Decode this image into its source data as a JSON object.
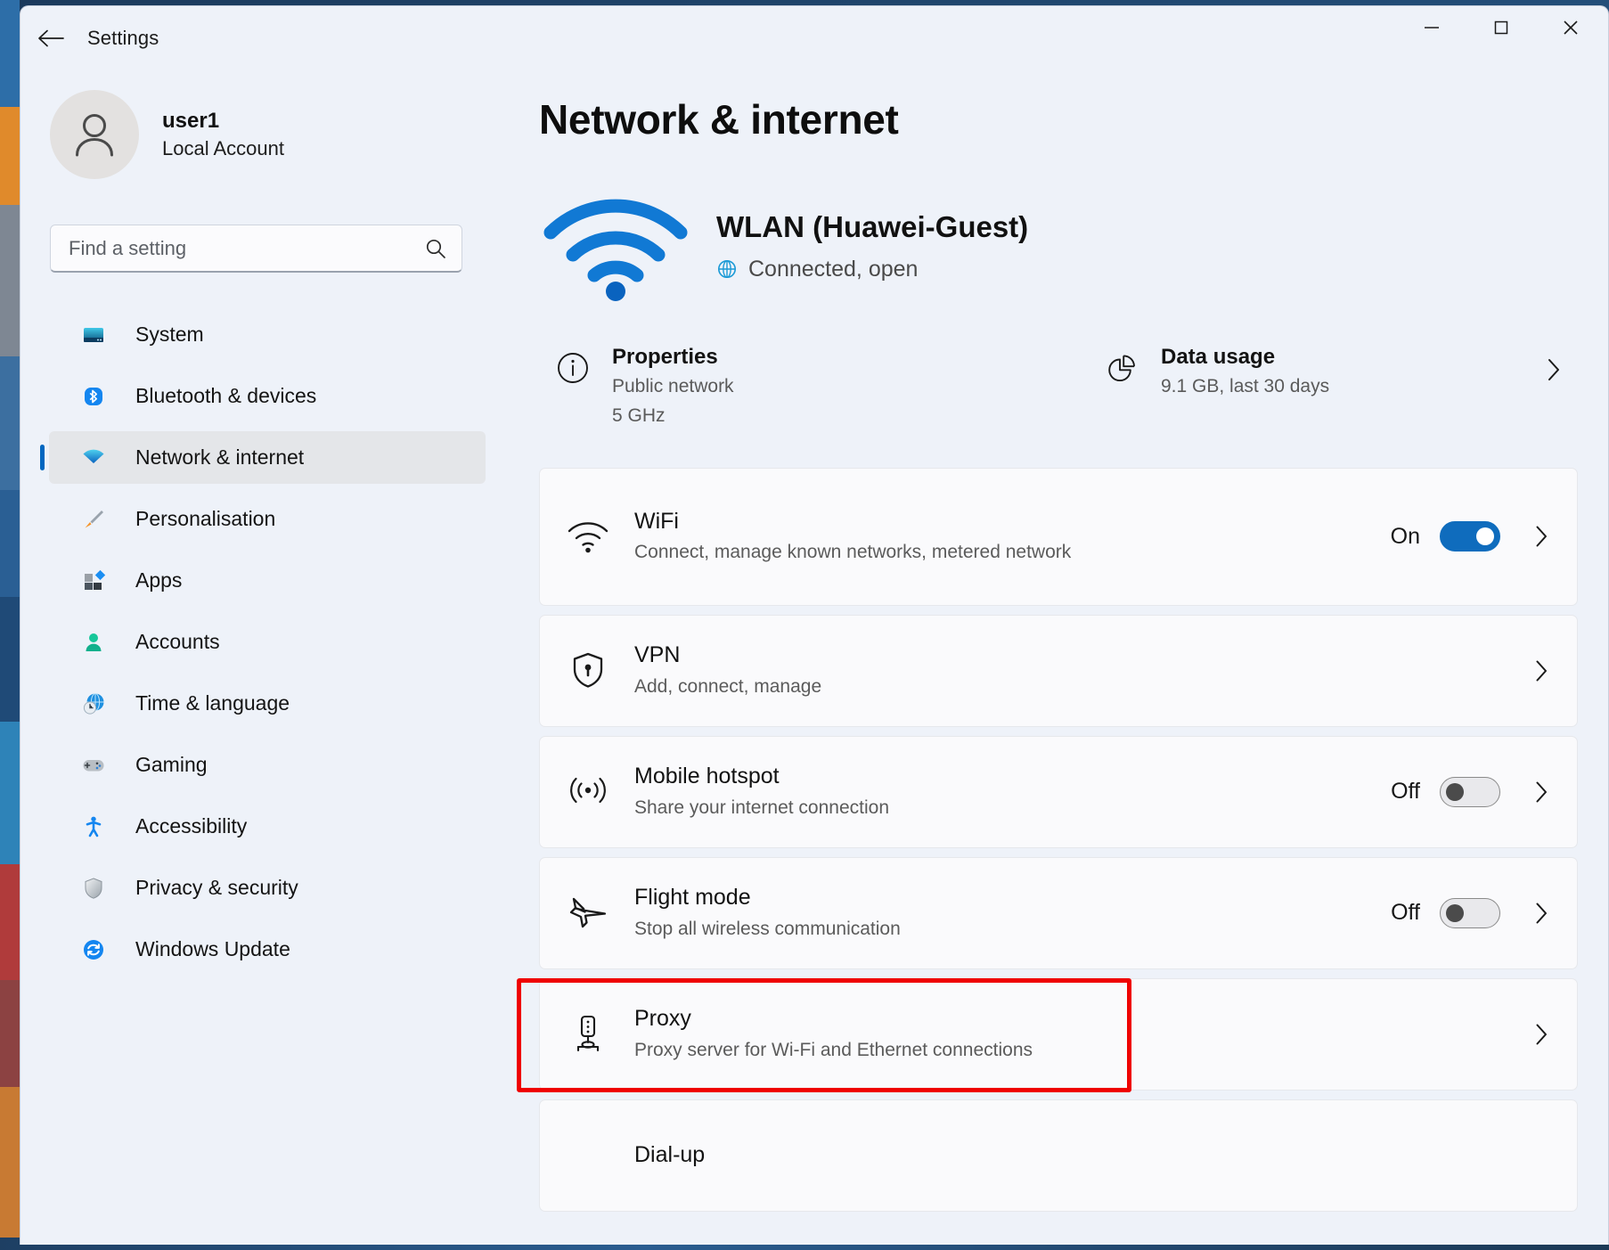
{
  "window": {
    "title": "Settings",
    "back_label": "Back",
    "minimize_label": "Minimize",
    "maximize_label": "Maximize",
    "close_label": "Close"
  },
  "account": {
    "name": "user1",
    "type": "Local Account"
  },
  "search": {
    "placeholder": "Find a setting",
    "value": ""
  },
  "sidebar": {
    "items": [
      {
        "label": "System",
        "icon": "monitor-icon",
        "active": false
      },
      {
        "label": "Bluetooth & devices",
        "icon": "bluetooth-icon",
        "active": false
      },
      {
        "label": "Network & internet",
        "icon": "wifi-icon",
        "active": true
      },
      {
        "label": "Personalisation",
        "icon": "paintbrush-icon",
        "active": false
      },
      {
        "label": "Apps",
        "icon": "apps-icon",
        "active": false
      },
      {
        "label": "Accounts",
        "icon": "person-icon",
        "active": false
      },
      {
        "label": "Time & language",
        "icon": "clock-globe-icon",
        "active": false
      },
      {
        "label": "Gaming",
        "icon": "gamepad-icon",
        "active": false
      },
      {
        "label": "Accessibility",
        "icon": "accessibility-icon",
        "active": false
      },
      {
        "label": "Privacy & security",
        "icon": "shield-icon",
        "active": false
      },
      {
        "label": "Windows Update",
        "icon": "update-icon",
        "active": false
      }
    ]
  },
  "main": {
    "page_title": "Network & internet",
    "hero": {
      "icon": "wifi-signal-icon",
      "name": "WLAN (Huawei-Guest)",
      "status_icon": "globe-icon",
      "status": "Connected, open"
    },
    "summary": [
      {
        "icon": "info-icon",
        "title": "Properties",
        "sub1": "Public network",
        "sub2": "5 GHz",
        "chevron": false
      },
      {
        "icon": "pie-chart-icon",
        "title": "Data usage",
        "sub1": "9.1 GB, last 30 days",
        "sub2": "",
        "chevron": true
      }
    ],
    "cards": [
      {
        "icon": "wifi-small-icon",
        "title": "WiFi",
        "sub": "Connect, manage known networks, metered network",
        "state": "On",
        "toggle": "on",
        "chevron": true,
        "highlighted": false
      },
      {
        "icon": "vpn-shield-icon",
        "title": "VPN",
        "sub": "Add, connect, manage",
        "state": "",
        "toggle": "none",
        "chevron": true,
        "highlighted": false
      },
      {
        "icon": "hotspot-icon",
        "title": "Mobile hotspot",
        "sub": "Share your internet connection",
        "state": "Off",
        "toggle": "off",
        "chevron": true,
        "highlighted": false
      },
      {
        "icon": "airplane-icon",
        "title": "Flight mode",
        "sub": "Stop all wireless communication",
        "state": "Off",
        "toggle": "off",
        "chevron": true,
        "highlighted": false
      },
      {
        "icon": "proxy-server-icon",
        "title": "Proxy",
        "sub": "Proxy server for Wi-Fi and Ethernet connections",
        "state": "",
        "toggle": "none",
        "chevron": true,
        "highlighted": true
      },
      {
        "icon": "dialup-icon",
        "title": "Dial-up",
        "sub": "",
        "state": "",
        "toggle": "none",
        "chevron": false,
        "highlighted": false
      }
    ]
  },
  "colors": {
    "accent": "#0f6cbd",
    "highlight": "#ef0000",
    "page_bg": "#eef2f9",
    "card_bg": "#fafafc",
    "selected_nav_bg": "#e4e6e9"
  }
}
